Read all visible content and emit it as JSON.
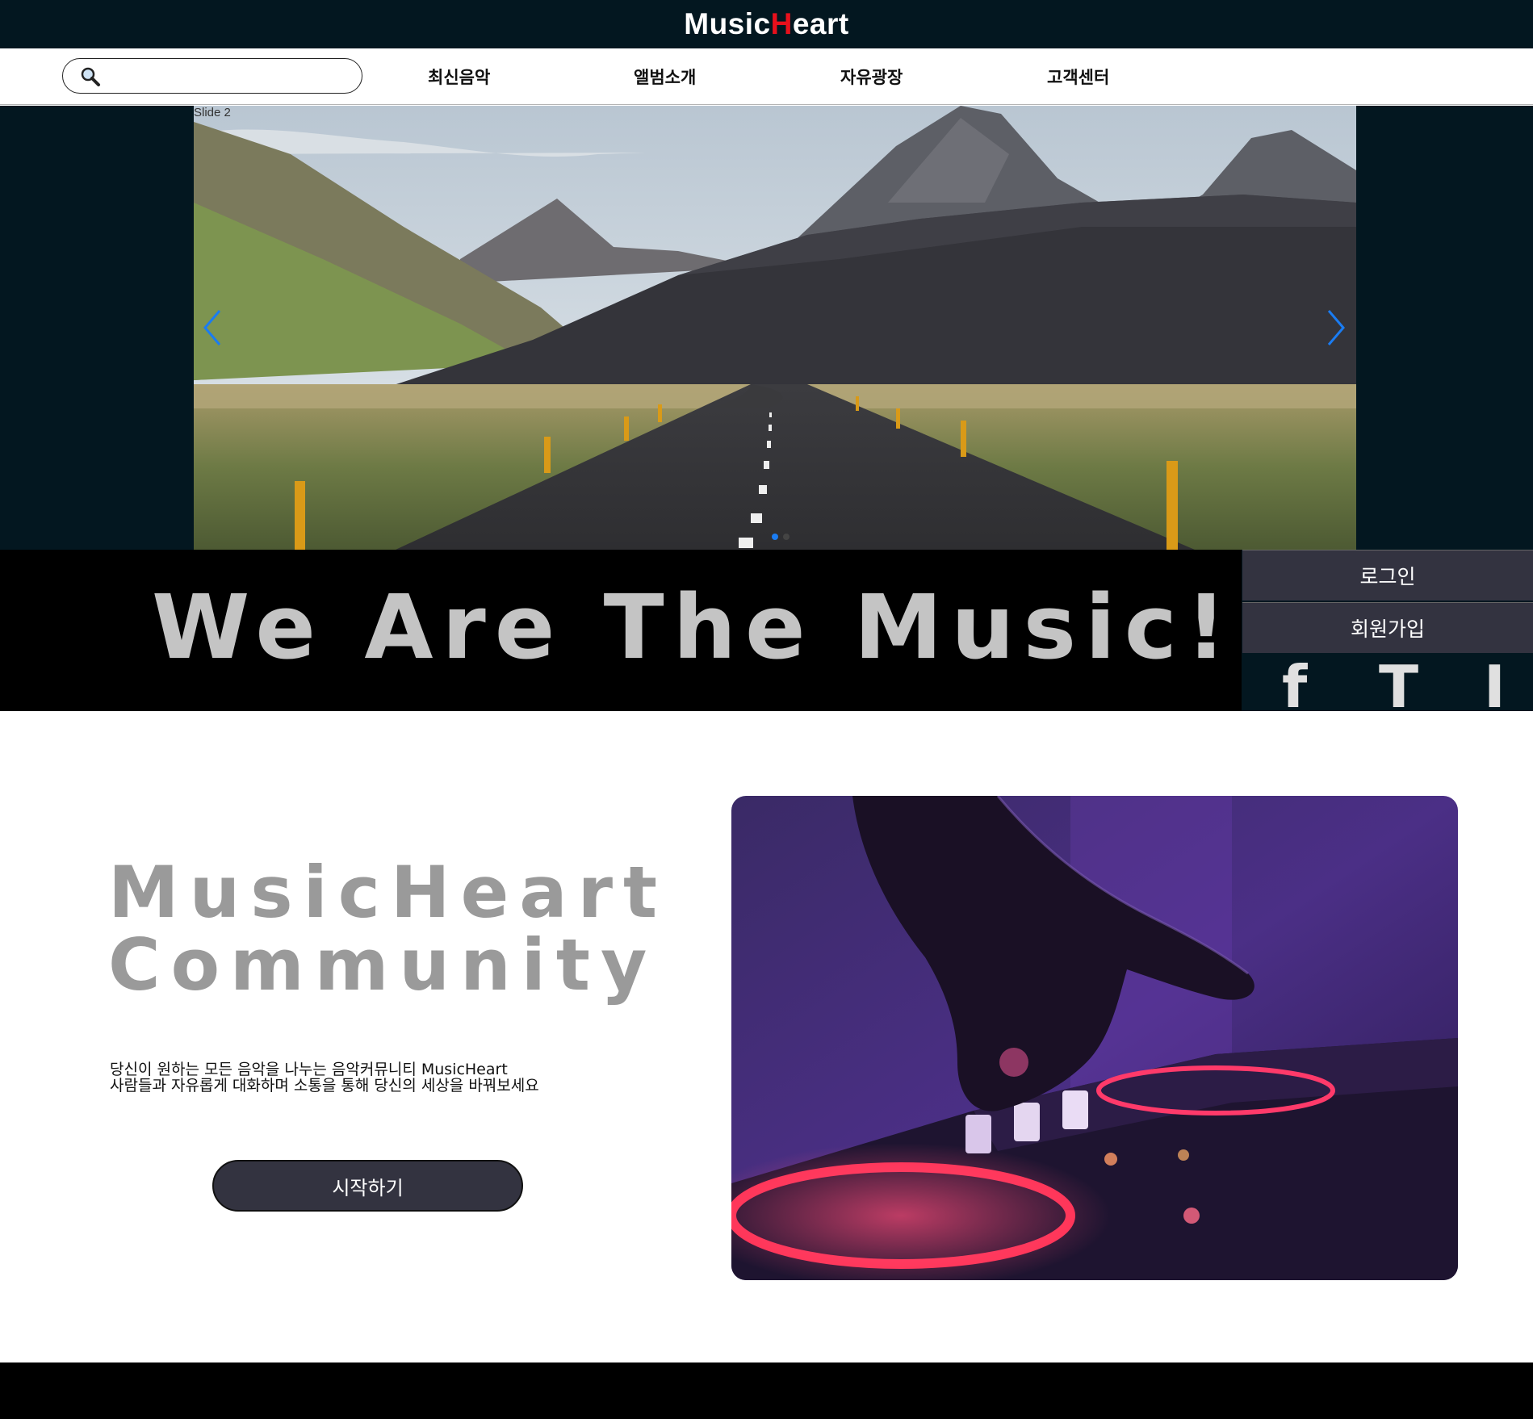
{
  "brand": {
    "prefix": "Music",
    "accent_letter": "H",
    "suffix": "eart",
    "accent_color": "#e8101c"
  },
  "search": {
    "placeholder": "",
    "value": ""
  },
  "nav": {
    "items": [
      "최신음악",
      "앨범소개",
      "자유광장",
      "고객센터"
    ]
  },
  "slider": {
    "label": "Slide 2",
    "active_index": 0,
    "dot_count": 2,
    "arrow_color": "#1a7cf2"
  },
  "band": {
    "title": "We Are The Music!"
  },
  "side": {
    "login_label": "로그인",
    "signup_label": "회원가입",
    "social": [
      "f",
      "T",
      "I"
    ]
  },
  "community": {
    "title_line1": "MusicHeart",
    "title_line2": "Community",
    "desc_line1": "당신이 원하는 모든 음악을 나누는 음악커뮤니티 MusicHeart",
    "desc_line2": "사람들과 자유롭게 대화하며 소통을 통해 당신의 세상을 바꿔보세요",
    "start_label": "시작하기"
  },
  "colors": {
    "header_bg": "#031720",
    "band_bg": "#000000",
    "button_bg": "#333340"
  }
}
